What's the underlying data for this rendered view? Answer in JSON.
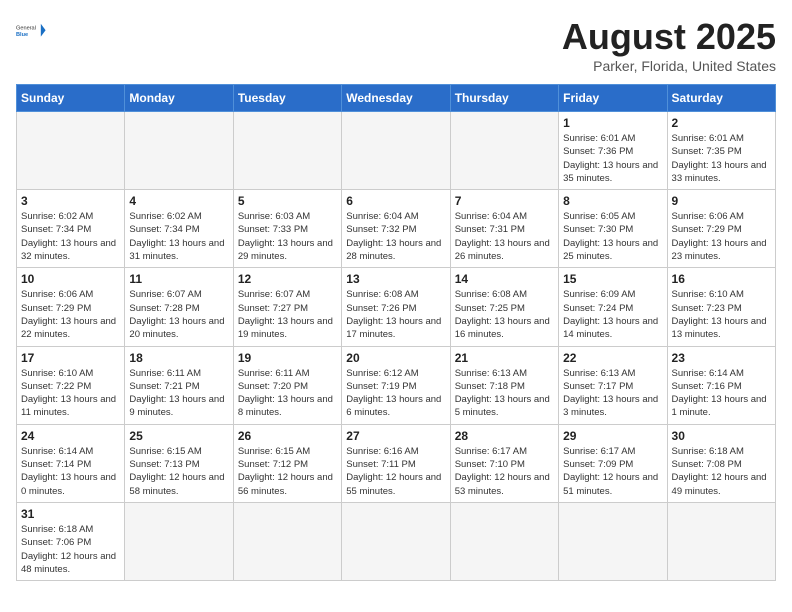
{
  "header": {
    "logo_general": "General",
    "logo_blue": "Blue",
    "month_title": "August 2025",
    "location": "Parker, Florida, United States"
  },
  "days_of_week": [
    "Sunday",
    "Monday",
    "Tuesday",
    "Wednesday",
    "Thursday",
    "Friday",
    "Saturday"
  ],
  "weeks": [
    [
      {
        "day": "",
        "info": ""
      },
      {
        "day": "",
        "info": ""
      },
      {
        "day": "",
        "info": ""
      },
      {
        "day": "",
        "info": ""
      },
      {
        "day": "",
        "info": ""
      },
      {
        "day": "1",
        "info": "Sunrise: 6:01 AM\nSunset: 7:36 PM\nDaylight: 13 hours and 35 minutes."
      },
      {
        "day": "2",
        "info": "Sunrise: 6:01 AM\nSunset: 7:35 PM\nDaylight: 13 hours and 33 minutes."
      }
    ],
    [
      {
        "day": "3",
        "info": "Sunrise: 6:02 AM\nSunset: 7:34 PM\nDaylight: 13 hours and 32 minutes."
      },
      {
        "day": "4",
        "info": "Sunrise: 6:02 AM\nSunset: 7:34 PM\nDaylight: 13 hours and 31 minutes."
      },
      {
        "day": "5",
        "info": "Sunrise: 6:03 AM\nSunset: 7:33 PM\nDaylight: 13 hours and 29 minutes."
      },
      {
        "day": "6",
        "info": "Sunrise: 6:04 AM\nSunset: 7:32 PM\nDaylight: 13 hours and 28 minutes."
      },
      {
        "day": "7",
        "info": "Sunrise: 6:04 AM\nSunset: 7:31 PM\nDaylight: 13 hours and 26 minutes."
      },
      {
        "day": "8",
        "info": "Sunrise: 6:05 AM\nSunset: 7:30 PM\nDaylight: 13 hours and 25 minutes."
      },
      {
        "day": "9",
        "info": "Sunrise: 6:06 AM\nSunset: 7:29 PM\nDaylight: 13 hours and 23 minutes."
      }
    ],
    [
      {
        "day": "10",
        "info": "Sunrise: 6:06 AM\nSunset: 7:29 PM\nDaylight: 13 hours and 22 minutes."
      },
      {
        "day": "11",
        "info": "Sunrise: 6:07 AM\nSunset: 7:28 PM\nDaylight: 13 hours and 20 minutes."
      },
      {
        "day": "12",
        "info": "Sunrise: 6:07 AM\nSunset: 7:27 PM\nDaylight: 13 hours and 19 minutes."
      },
      {
        "day": "13",
        "info": "Sunrise: 6:08 AM\nSunset: 7:26 PM\nDaylight: 13 hours and 17 minutes."
      },
      {
        "day": "14",
        "info": "Sunrise: 6:08 AM\nSunset: 7:25 PM\nDaylight: 13 hours and 16 minutes."
      },
      {
        "day": "15",
        "info": "Sunrise: 6:09 AM\nSunset: 7:24 PM\nDaylight: 13 hours and 14 minutes."
      },
      {
        "day": "16",
        "info": "Sunrise: 6:10 AM\nSunset: 7:23 PM\nDaylight: 13 hours and 13 minutes."
      }
    ],
    [
      {
        "day": "17",
        "info": "Sunrise: 6:10 AM\nSunset: 7:22 PM\nDaylight: 13 hours and 11 minutes."
      },
      {
        "day": "18",
        "info": "Sunrise: 6:11 AM\nSunset: 7:21 PM\nDaylight: 13 hours and 9 minutes."
      },
      {
        "day": "19",
        "info": "Sunrise: 6:11 AM\nSunset: 7:20 PM\nDaylight: 13 hours and 8 minutes."
      },
      {
        "day": "20",
        "info": "Sunrise: 6:12 AM\nSunset: 7:19 PM\nDaylight: 13 hours and 6 minutes."
      },
      {
        "day": "21",
        "info": "Sunrise: 6:13 AM\nSunset: 7:18 PM\nDaylight: 13 hours and 5 minutes."
      },
      {
        "day": "22",
        "info": "Sunrise: 6:13 AM\nSunset: 7:17 PM\nDaylight: 13 hours and 3 minutes."
      },
      {
        "day": "23",
        "info": "Sunrise: 6:14 AM\nSunset: 7:16 PM\nDaylight: 13 hours and 1 minute."
      }
    ],
    [
      {
        "day": "24",
        "info": "Sunrise: 6:14 AM\nSunset: 7:14 PM\nDaylight: 13 hours and 0 minutes."
      },
      {
        "day": "25",
        "info": "Sunrise: 6:15 AM\nSunset: 7:13 PM\nDaylight: 12 hours and 58 minutes."
      },
      {
        "day": "26",
        "info": "Sunrise: 6:15 AM\nSunset: 7:12 PM\nDaylight: 12 hours and 56 minutes."
      },
      {
        "day": "27",
        "info": "Sunrise: 6:16 AM\nSunset: 7:11 PM\nDaylight: 12 hours and 55 minutes."
      },
      {
        "day": "28",
        "info": "Sunrise: 6:17 AM\nSunset: 7:10 PM\nDaylight: 12 hours and 53 minutes."
      },
      {
        "day": "29",
        "info": "Sunrise: 6:17 AM\nSunset: 7:09 PM\nDaylight: 12 hours and 51 minutes."
      },
      {
        "day": "30",
        "info": "Sunrise: 6:18 AM\nSunset: 7:08 PM\nDaylight: 12 hours and 49 minutes."
      }
    ],
    [
      {
        "day": "31",
        "info": "Sunrise: 6:18 AM\nSunset: 7:06 PM\nDaylight: 12 hours and 48 minutes."
      },
      {
        "day": "",
        "info": ""
      },
      {
        "day": "",
        "info": ""
      },
      {
        "day": "",
        "info": ""
      },
      {
        "day": "",
        "info": ""
      },
      {
        "day": "",
        "info": ""
      },
      {
        "day": "",
        "info": ""
      }
    ]
  ]
}
